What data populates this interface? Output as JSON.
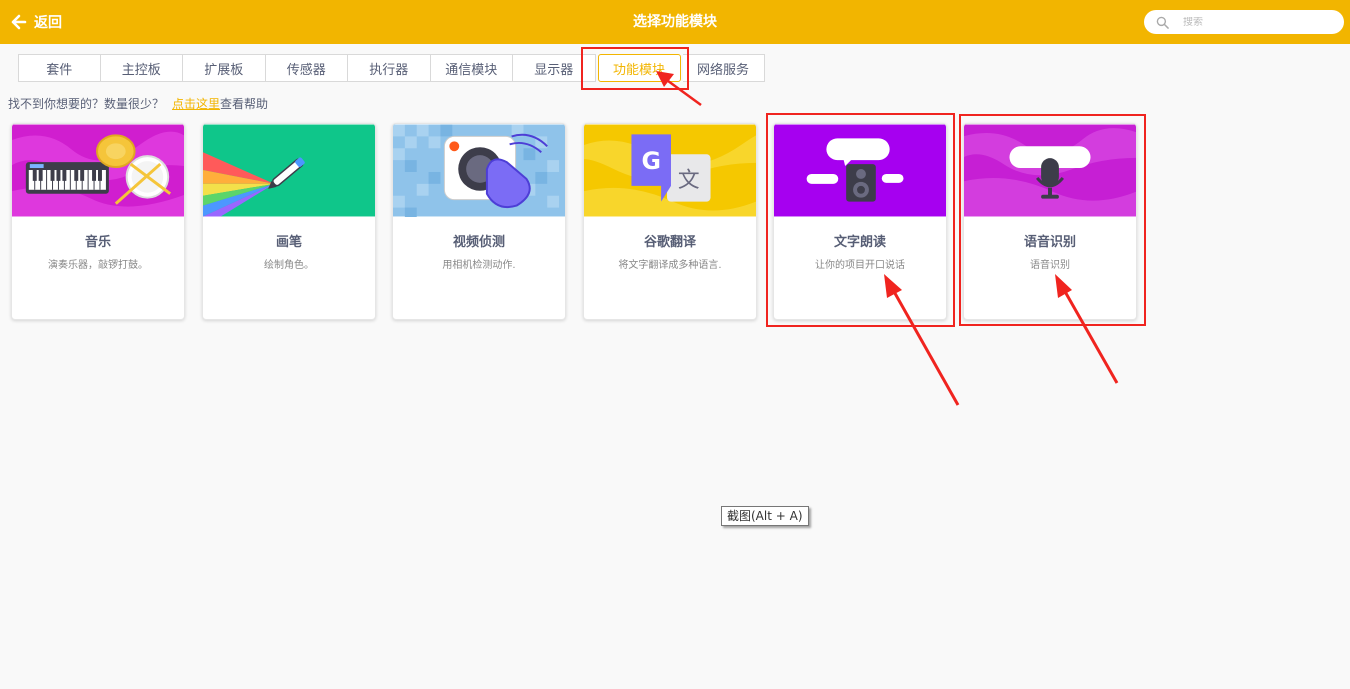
{
  "header": {
    "back_label": "返回",
    "title": "选择功能模块",
    "search_placeholder": "搜索",
    "background": "#f2b500"
  },
  "tabs": [
    {
      "label": "套件",
      "active": false
    },
    {
      "label": "主控板",
      "active": false
    },
    {
      "label": "扩展板",
      "active": false
    },
    {
      "label": "传感器",
      "active": false
    },
    {
      "label": "执行器",
      "active": false
    },
    {
      "label": "通信模块",
      "active": false
    },
    {
      "label": "显示器",
      "active": false
    },
    {
      "label": "功能模块",
      "active": true
    },
    {
      "label": "网络服务",
      "active": false
    }
  ],
  "help": {
    "prefix": "找不到你想要的？数量很少？",
    "link": "点击这里",
    "suffix": "查看帮助"
  },
  "cards": [
    {
      "title": "音乐",
      "desc": "演奏乐器，敲锣打鼓。",
      "bg": "#d01ecf",
      "icon": "music-icon"
    },
    {
      "title": "画笔",
      "desc": "绘制角色。",
      "bg": "#0fc68a",
      "icon": "pen-icon"
    },
    {
      "title": "视频侦测",
      "desc": "用相机检测动作.",
      "bg": "#8fc3ea",
      "icon": "video-sensing-icon"
    },
    {
      "title": "谷歌翻译",
      "desc": "将文字翻译成多种语言.",
      "bg": "#f5c800",
      "icon": "translate-icon"
    },
    {
      "title": "文字朗读",
      "desc": "让你的项目开口说话",
      "bg": "#a600f0",
      "icon": "text-to-speech-icon"
    },
    {
      "title": "语音识别",
      "desc": "语音识别",
      "bg": "#c61fd4",
      "icon": "speech-recognition-icon"
    }
  ],
  "tooltip": "截图(Alt + A)",
  "annotation_color": "#f0241f"
}
